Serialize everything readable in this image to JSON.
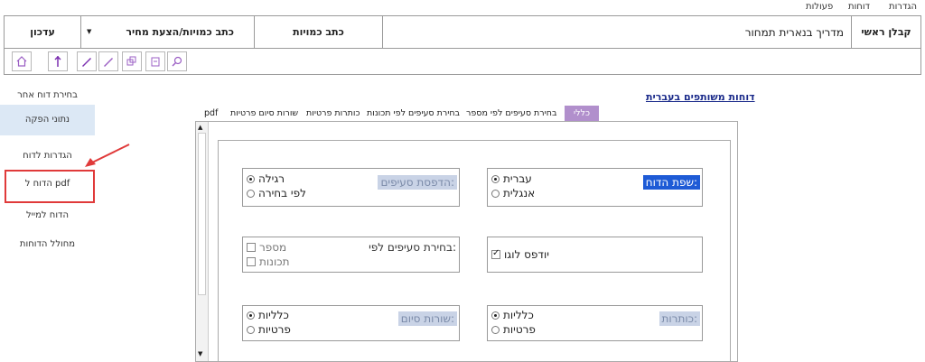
{
  "menu": {
    "items": [
      "הגדרות",
      "דוחות",
      "פעולות"
    ]
  },
  "header": {
    "cells": [
      "קבלן ראשי",
      "מדריך בנארית תמחור",
      "כתב כמויות",
      "כתב כמויות/הצעת מחיר",
      "עדכון"
    ]
  },
  "toolbar": {
    "icons": [
      "home-icon",
      "pin-icon",
      "pencil-up-icon",
      "pencil-down-icon",
      "copy-icon",
      "export-icon",
      "search-icon"
    ]
  },
  "sidebar": {
    "items": [
      "בחירת דוח אחר",
      "נתוני הפקה",
      "הגדרות לדוח",
      "הדוח ל pdf",
      "הדוח למייל",
      "מחולל הדוחות"
    ]
  },
  "main": {
    "title": "דוחות משותפים בעברית",
    "tabs": [
      "כללי",
      "בחירת סעיפים לפי מספר",
      "בחירת סעיפים לפי תכונות",
      "כותרות פרטיות",
      "שורות סיום פרטיות",
      "pdf"
    ]
  },
  "groups": {
    "language": {
      "title": "שפת הדוח:",
      "options": [
        "עברית",
        "אנגלית"
      ]
    },
    "print_items": {
      "title": "הדפסת סעיפים:",
      "options": [
        "רגילה",
        "לפי בחירה"
      ]
    },
    "logo": {
      "label": "יודפס לוגו"
    },
    "select_by": {
      "title": "בחירת סעיפים לפי:",
      "options": [
        "מספר",
        "תכונות"
      ]
    },
    "headers": {
      "title": "כותרות:",
      "options": [
        "כלליות",
        "פרטיות"
      ]
    },
    "end_rows": {
      "title": "שורות סיום:",
      "options": [
        "כלליות",
        "פרטיות"
      ]
    }
  },
  "colors": {
    "accent": "#1e5bd6",
    "tab_active": "#b18fcc",
    "sidebar_active": "#dce8f5",
    "annotation": "#e03a3a"
  }
}
